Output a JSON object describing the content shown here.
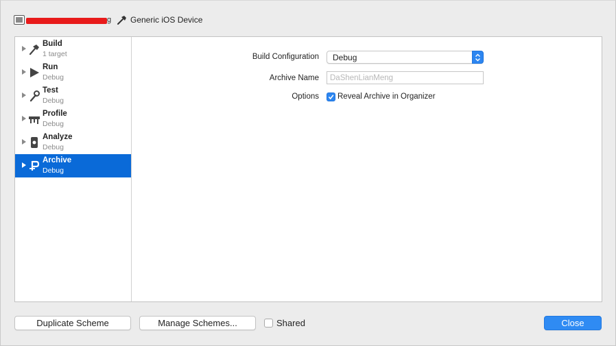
{
  "header": {
    "scheme_tail": "g",
    "destination": "Generic iOS Device"
  },
  "sidebar": {
    "items": [
      {
        "title": "Build",
        "subtitle": "1 target",
        "icon": "hammer-icon",
        "selected": false
      },
      {
        "title": "Run",
        "subtitle": "Debug",
        "icon": "play-icon",
        "selected": false
      },
      {
        "title": "Test",
        "subtitle": "Debug",
        "icon": "wrench-icon",
        "selected": false
      },
      {
        "title": "Profile",
        "subtitle": "Debug",
        "icon": "instruments-icon",
        "selected": false
      },
      {
        "title": "Analyze",
        "subtitle": "Debug",
        "icon": "analyze-icon",
        "selected": false
      },
      {
        "title": "Archive",
        "subtitle": "Debug",
        "icon": "archive-icon",
        "selected": true
      }
    ]
  },
  "form": {
    "build_config_label": "Build Configuration",
    "build_config_value": "Debug",
    "archive_name_label": "Archive Name",
    "archive_name_placeholder": "DaShenLianMeng",
    "options_label": "Options",
    "reveal_label": "Reveal Archive in Organizer",
    "reveal_checked": true
  },
  "footer": {
    "duplicate_label": "Duplicate Scheme",
    "manage_label": "Manage Schemes...",
    "shared_label": "Shared",
    "shared_checked": false,
    "close_label": "Close"
  },
  "colors": {
    "accent": "#0a6ad8",
    "redaction": "#e81a1a"
  }
}
